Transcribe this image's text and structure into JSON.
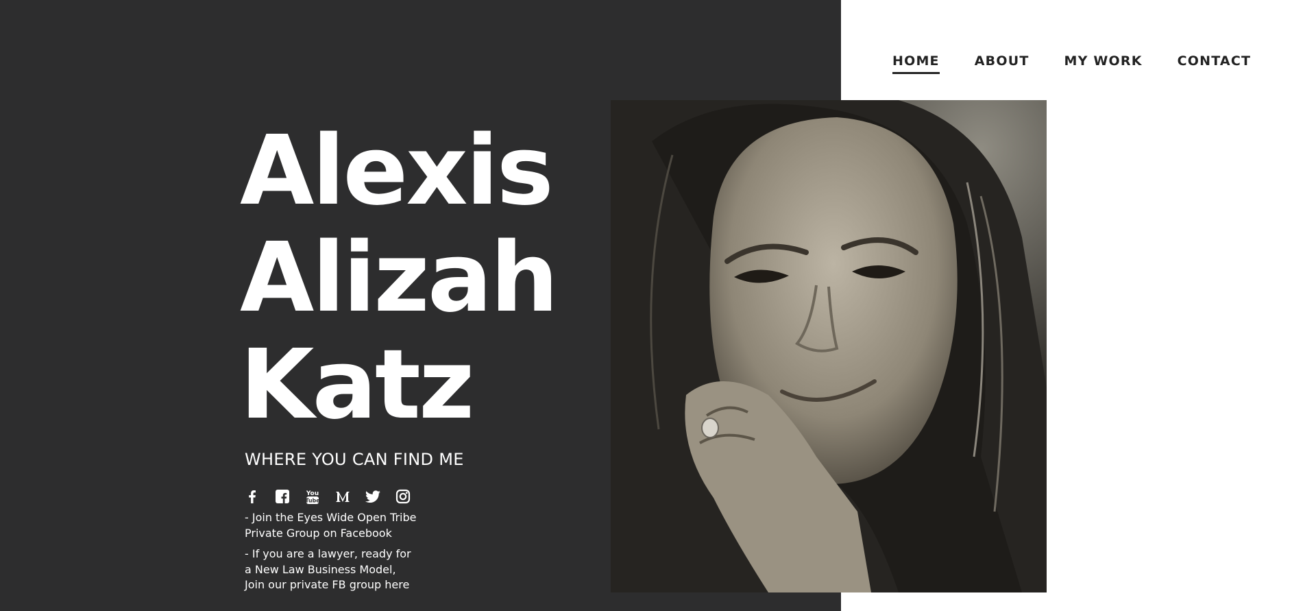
{
  "nav": {
    "items": [
      {
        "label": "HOME",
        "active": true
      },
      {
        "label": "ABOUT",
        "active": false
      },
      {
        "label": "MY WORK",
        "active": false
      },
      {
        "label": "CONTACT",
        "active": false
      }
    ]
  },
  "hero": {
    "name_lines": [
      "Alexis",
      "Alizah",
      "Katz"
    ],
    "find_heading": "WHERE YOU CAN FIND ME"
  },
  "social": {
    "icons": [
      "facebook-icon",
      "facebook-square-icon",
      "youtube-icon",
      "medium-icon",
      "twitter-icon",
      "instagram-icon"
    ]
  },
  "links": {
    "tribe": [
      "- Join the Eyes Wide Open Tribe",
      "Private Group on Facebook"
    ],
    "lawyer": [
      "- If you are a lawyer, ready for",
      "a New Law Business Model,",
      "Join our private FB group here"
    ]
  },
  "colors": {
    "dark_panel": "#2d2d2e",
    "text_light": "#ffffff",
    "nav_text": "#222222"
  }
}
